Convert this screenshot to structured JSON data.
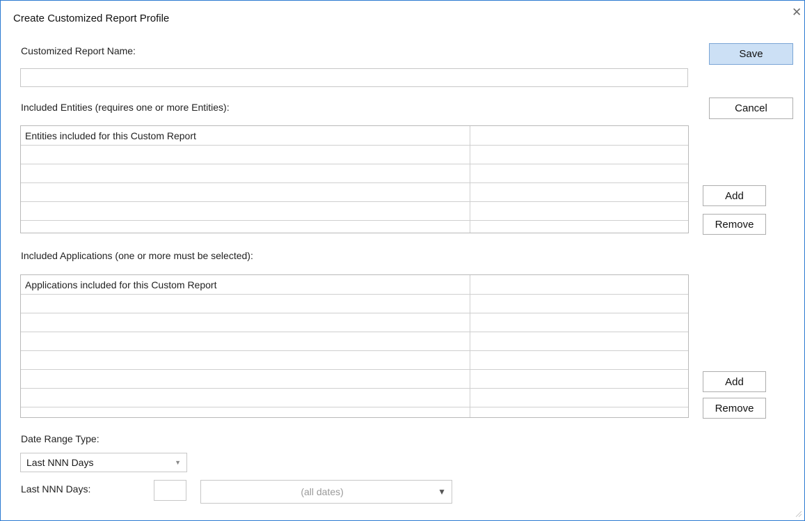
{
  "window": {
    "title": "Create Customized Report Profile"
  },
  "icons": {
    "close": "close-icon",
    "dropdown": "chevron-down-icon",
    "resize": "resize-grip-icon"
  },
  "form": {
    "report_name_label": "Customized Report Name:",
    "report_name_value": "",
    "entities_label": "Included Entities (requires one or more Entities):",
    "entities_grid": {
      "header": "Entities included for this Custom Report",
      "header2": "",
      "row_count": 5
    },
    "applications_label": "Included Applications (one or more must be selected):",
    "applications_grid": {
      "header": "Applications included for this Custom Report",
      "header2": "",
      "row_count": 7
    },
    "date_range_label": "Date Range Type:",
    "date_range_value": "Last NNN Days",
    "last_days_label": "Last NNN Days:",
    "last_days_value": "",
    "all_dates_value": "(all dates)"
  },
  "buttons": {
    "save": "Save",
    "cancel": "Cancel",
    "entities_add": "Add",
    "entities_remove": "Remove",
    "applications_add": "Add",
    "applications_remove": "Remove"
  },
  "colors": {
    "window_border": "#2b79d0",
    "primary_button_bg": "#cce0f5"
  }
}
